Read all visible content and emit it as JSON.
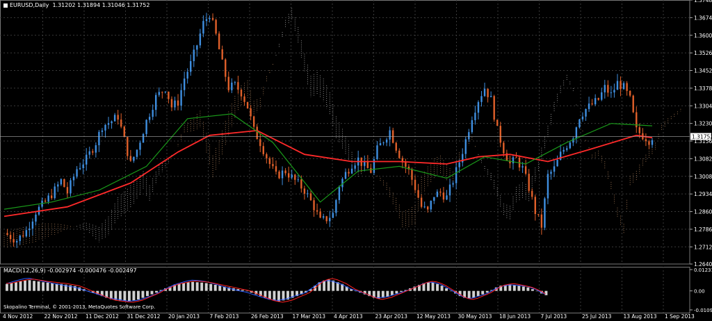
{
  "header": {
    "symbol": "EURUSD,Daily",
    "ohlc": "1.31202 1.31894 1.31046 1.31752"
  },
  "macd": {
    "title": "MACD(12,26,9) -0.002974 -0.000476 -0.002497"
  },
  "footer": {
    "copyright": "Skopalino Terminal, © 2001-2013, MetaQuotes Software Corp."
  },
  "colors": {
    "background": "#000000",
    "bull": "#3f8fe0",
    "bear": "#e0602a",
    "ma_red": "#ff2a2a",
    "ma_green": "#1a9a1a",
    "cloud_tan": "#d9a070",
    "cloud_white": "#d0d0d0",
    "grid": "#3a3a3a",
    "macd_hist": "#d0d0d0",
    "macd_blue": "#2a5aff",
    "macd_red": "#ff2020",
    "arrow_green": "#20ff40",
    "arrow_red": "#ff2040",
    "current_price_bg": "#ffffff"
  },
  "chart_data": [
    {
      "type": "candlestick",
      "title": "EURUSD,Daily 1.31202 1.31894 1.31046 1.31752",
      "x_tick_labels": [
        "4 Nov 2012",
        "22 Nov 2012",
        "11 Dec 2012",
        "31 Dec 2012",
        "20 Jan 2013",
        "7 Feb 2013",
        "26 Feb 2013",
        "17 Mar 2013",
        "4 Apr 2013",
        "23 Apr 2013",
        "12 May 2013",
        "30 May 2013",
        "18 Jun 2013",
        "7 Jul 2013",
        "25 Jul 2013",
        "13 Aug 2013",
        "1 Sep 2013"
      ],
      "y_tick_labels": [
        "1.37480",
        "1.36740",
        "1.36000",
        "1.35260",
        "1.34520",
        "1.33780",
        "1.33040",
        "1.32300",
        "1.31560",
        "1.30820",
        "1.30080",
        "1.29340",
        "1.28600",
        "1.27860",
        "1.27120",
        "1.26400"
      ],
      "ylim": [
        1.264,
        1.3748
      ],
      "current_price": "1.31752",
      "grid": true,
      "close_path": [
        [
          0,
          1.277
        ],
        [
          4,
          1.274
        ],
        [
          7,
          1.278
        ],
        [
          10,
          1.286
        ],
        [
          13,
          1.29
        ],
        [
          16,
          1.295
        ],
        [
          18,
          1.299
        ],
        [
          20,
          1.294
        ],
        [
          23,
          1.304
        ],
        [
          26,
          1.308
        ],
        [
          29,
          1.315
        ],
        [
          31,
          1.322
        ],
        [
          34,
          1.324
        ],
        [
          36,
          1.326
        ],
        [
          38,
          1.316
        ],
        [
          40,
          1.306
        ],
        [
          42,
          1.312
        ],
        [
          45,
          1.324
        ],
        [
          48,
          1.334
        ],
        [
          51,
          1.338
        ],
        [
          53,
          1.33
        ],
        [
          55,
          1.332
        ],
        [
          57,
          1.342
        ],
        [
          59,
          1.348
        ],
        [
          61,
          1.356
        ],
        [
          63,
          1.365
        ],
        [
          65,
          1.369
        ],
        [
          67,
          1.36
        ],
        [
          69,
          1.348
        ],
        [
          71,
          1.338
        ],
        [
          73,
          1.339
        ],
        [
          75,
          1.336
        ],
        [
          77,
          1.33
        ],
        [
          79,
          1.32
        ],
        [
          81,
          1.315
        ],
        [
          84,
          1.306
        ],
        [
          86,
          1.301
        ],
        [
          89,
          1.303
        ],
        [
          92,
          1.299
        ],
        [
          95,
          1.295
        ],
        [
          98,
          1.288
        ],
        [
          100,
          1.282
        ],
        [
          102,
          1.283
        ],
        [
          104,
          1.285
        ],
        [
          106,
          1.297
        ],
        [
          108,
          1.302
        ],
        [
          110,
          1.306
        ],
        [
          112,
          1.308
        ],
        [
          114,
          1.305
        ],
        [
          116,
          1.303
        ],
        [
          118,
          1.312
        ],
        [
          120,
          1.316
        ],
        [
          122,
          1.32
        ],
        [
          124,
          1.313
        ],
        [
          126,
          1.307
        ],
        [
          128,
          1.303
        ],
        [
          130,
          1.296
        ],
        [
          132,
          1.288
        ],
        [
          134,
          1.286
        ],
        [
          136,
          1.293
        ],
        [
          138,
          1.294
        ],
        [
          140,
          1.292
        ],
        [
          142,
          1.299
        ],
        [
          144,
          1.307
        ],
        [
          146,
          1.316
        ],
        [
          148,
          1.326
        ],
        [
          150,
          1.333
        ],
        [
          152,
          1.338
        ],
        [
          154,
          1.333
        ],
        [
          156,
          1.32
        ],
        [
          158,
          1.312
        ],
        [
          160,
          1.306
        ],
        [
          162,
          1.308
        ],
        [
          164,
          1.304
        ],
        [
          166,
          1.296
        ],
        [
          168,
          1.286
        ],
        [
          170,
          1.28
        ],
        [
          172,
          1.301
        ],
        [
          174,
          1.304
        ],
        [
          176,
          1.31
        ],
        [
          178,
          1.314
        ],
        [
          180,
          1.318
        ],
        [
          182,
          1.326
        ],
        [
          184,
          1.329
        ],
        [
          186,
          1.331
        ],
        [
          188,
          1.333
        ],
        [
          190,
          1.338
        ],
        [
          192,
          1.335
        ],
        [
          194,
          1.34
        ],
        [
          196,
          1.338
        ],
        [
          198,
          1.333
        ],
        [
          200,
          1.32
        ],
        [
          202,
          1.318
        ],
        [
          204,
          1.316
        ],
        [
          205,
          1.3175
        ]
      ],
      "series": [
        {
          "name": "",
          "role": "ma_fast",
          "points": [
            [
              0,
              1.284
            ],
            [
              20,
              1.288
            ],
            [
              40,
              1.298
            ],
            [
              55,
              1.311
            ],
            [
              65,
              1.318
            ],
            [
              80,
              1.32
            ],
            [
              95,
              1.31
            ],
            [
              110,
              1.307
            ],
            [
              125,
              1.307
            ],
            [
              140,
              1.306
            ],
            [
              150,
              1.309
            ],
            [
              160,
              1.31
            ],
            [
              172,
              1.307
            ],
            [
              185,
              1.312
            ],
            [
              200,
              1.318
            ],
            [
              205,
              1.317
            ]
          ]
        },
        {
          "name": "",
          "role": "ma_slow",
          "points": [
            [
              0,
              1.287
            ],
            [
              15,
              1.29
            ],
            [
              30,
              1.295
            ],
            [
              45,
              1.305
            ],
            [
              58,
              1.325
            ],
            [
              72,
              1.327
            ],
            [
              85,
              1.315
            ],
            [
              100,
              1.29
            ],
            [
              112,
              1.303
            ],
            [
              125,
              1.305
            ],
            [
              140,
              1.3
            ],
            [
              152,
              1.309
            ],
            [
              165,
              1.306
            ],
            [
              178,
              1.315
            ],
            [
              192,
              1.323
            ],
            [
              205,
              1.322
            ]
          ]
        }
      ]
    },
    {
      "type": "macd",
      "title": "MACD(12,26,9) -0.002974 -0.000476 -0.002497",
      "y_tick_labels": [
        "0.012318",
        "0.00",
        "-0.010975"
      ],
      "ylim": [
        -0.010975,
        0.012318
      ],
      "histogram": [
        0.004,
        0.0045,
        0.005,
        0.0055,
        0.006,
        0.0062,
        0.0058,
        0.0055,
        0.005,
        0.0048,
        0.0045,
        0.0042,
        0.004,
        0.0036,
        0.0032,
        0.0028,
        0.002,
        0.001,
        0.0,
        -0.001,
        -0.002,
        -0.003,
        -0.004,
        -0.0048,
        -0.0052,
        -0.0055,
        -0.0058,
        -0.006,
        -0.0055,
        -0.005,
        -0.004,
        -0.003,
        -0.002,
        -0.001,
        0.0005,
        0.0015,
        0.0025,
        0.0035,
        0.004,
        0.0045,
        0.005,
        0.0052,
        0.005,
        0.0048,
        0.0045,
        0.004,
        0.0035,
        0.003,
        0.0025,
        0.002,
        0.0015,
        0.001,
        0.0005,
        0.0,
        -0.001,
        -0.002,
        -0.003,
        -0.004,
        -0.005,
        -0.0055,
        -0.006,
        -0.0055,
        -0.005,
        -0.004,
        -0.003,
        -0.002,
        -0.001,
        0.001,
        0.003,
        0.005,
        0.006,
        0.0065,
        0.006,
        0.005,
        0.004,
        0.0025,
        0.001,
        0.0,
        -0.001,
        -0.002,
        -0.003,
        -0.004,
        -0.0045,
        -0.004,
        -0.0035,
        -0.0025,
        -0.0015,
        -0.0005,
        0.0005,
        0.0015,
        0.0025,
        0.0035,
        0.0045,
        0.005,
        0.0048,
        0.004,
        0.003,
        0.0015,
        0.0,
        -0.0015,
        -0.003,
        -0.004,
        -0.0045,
        -0.004,
        -0.003,
        -0.002,
        -0.001,
        0.0005,
        0.002,
        0.003,
        0.0035,
        0.0038,
        0.0035,
        0.003,
        0.0025,
        0.002,
        0.001,
        0.0,
        -0.0015,
        -0.0025
      ]
    }
  ]
}
